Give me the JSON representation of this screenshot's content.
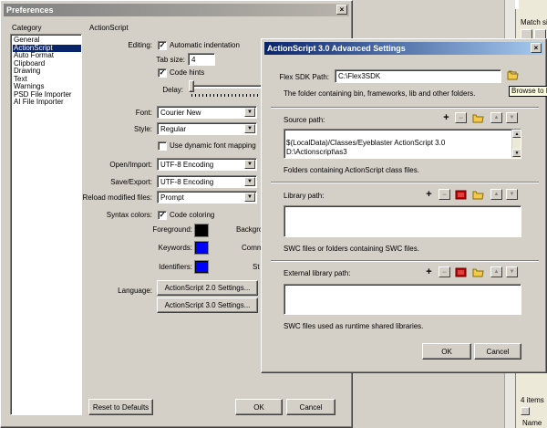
{
  "background_app": {
    "match_size_label": "Match si",
    "items_count": "4 items",
    "name_header": "Name"
  },
  "preferences": {
    "title": "Preferences",
    "category_label": "Category",
    "section_title": "ActionScript",
    "categories": [
      {
        "label": "General",
        "selected": false
      },
      {
        "label": "ActionScript",
        "selected": true
      },
      {
        "label": "Auto Format",
        "selected": false
      },
      {
        "label": "Clipboard",
        "selected": false
      },
      {
        "label": "Drawing",
        "selected": false
      },
      {
        "label": "Text",
        "selected": false
      },
      {
        "label": "Warnings",
        "selected": false
      },
      {
        "label": "PSD File Importer",
        "selected": false
      },
      {
        "label": "AI File Importer",
        "selected": false
      }
    ],
    "editing_label": "Editing:",
    "auto_indent_label": "Automatic indentation",
    "tab_size_label": "Tab size:",
    "tab_size_value": "4",
    "code_hints_label": "Code hints",
    "delay_label": "Delay:",
    "font_label": "Font:",
    "font_value": "Courier New",
    "style_label": "Style:",
    "style_value": "Regular",
    "dynamic_font_label": "Use dynamic font mapping",
    "open_import_label": "Open/Import:",
    "open_import_value": "UTF-8 Encoding",
    "save_export_label": "Save/Export:",
    "save_export_value": "UTF-8 Encoding",
    "reload_label": "Reload modified files:",
    "reload_value": "Prompt",
    "syntax_colors_label": "Syntax colors:",
    "code_coloring_label": "Code coloring",
    "foreground_label": "Foreground:",
    "background_label": "Backgro",
    "keywords_label": "Keywords:",
    "comments_label": "Comm",
    "identifiers_label": "Identifiers:",
    "strings_label": "St",
    "foreground_color": "#000000",
    "keywords_color": "#0000ff",
    "identifiers_color": "#0000ff",
    "language_label": "Language:",
    "as2_button": "ActionScript 2.0 Settings...",
    "as3_button": "ActionScript 3.0 Settings...",
    "reset_button": "Reset to Defaults",
    "ok_button": "OK",
    "cancel_button": "Cancel",
    "close_glyph": "×"
  },
  "as3_dialog": {
    "title": "ActionScript 3.0 Advanced Settings",
    "sdk_label": "Flex SDK Path:",
    "sdk_value": "C:\\Flex3SDK",
    "sdk_tooltip": "Browse to F",
    "sdk_help": "The folder containing bin, frameworks, lib and other folders.",
    "source_label": "Source path:",
    "source_paths": [
      "",
      "$(LocalData)/Classes/Eyeblaster ActionScript 3.0",
      "D:\\Actionscript\\as3"
    ],
    "source_help": "Folders containing ActionScript class files.",
    "library_label": "Library path:",
    "library_help": "SWC files or folders containing SWC files.",
    "external_label": "External library path:",
    "external_help": "SWC files used as runtime shared libraries.",
    "ok_button": "OK",
    "cancel_button": "Cancel",
    "close_glyph": "×",
    "plus_glyph": "+",
    "minus_glyph": "−",
    "up_glyph": "▲",
    "down_glyph": "▼"
  }
}
